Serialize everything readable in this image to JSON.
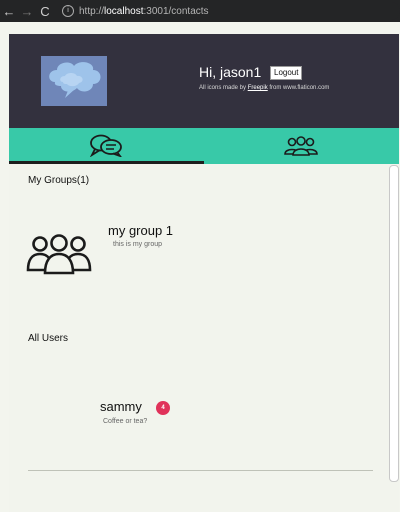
{
  "browser": {
    "back_icon": "←",
    "forward_icon": "→",
    "reload_icon": "C",
    "url_prefix": "http://",
    "url_host": "localhost",
    "url_rest": ":3001/contacts"
  },
  "header": {
    "greeting": "Hi, jason1",
    "logout_label": "Logout",
    "credits_prefix": "All icons made by ",
    "credits_author": "Freepik",
    "credits_suffix": " from www.flaticon.com"
  },
  "tabs": {
    "left_icon": "chat-bubbles-icon",
    "right_icon": "group-icon"
  },
  "groups": {
    "title": "My Groups(1)",
    "items": [
      {
        "name": "my group 1",
        "description": "this is my group",
        "icon": "group-icon"
      }
    ]
  },
  "users": {
    "title": "All Users",
    "items": [
      {
        "name": "sammy",
        "status": "Coffee or tea?",
        "badge": "4"
      }
    ]
  },
  "colors": {
    "header_bg": "#33313e",
    "tabbar_bg": "#38c9a8",
    "badge_bg": "#e0325a",
    "page_bg": "#f2f4ed"
  }
}
